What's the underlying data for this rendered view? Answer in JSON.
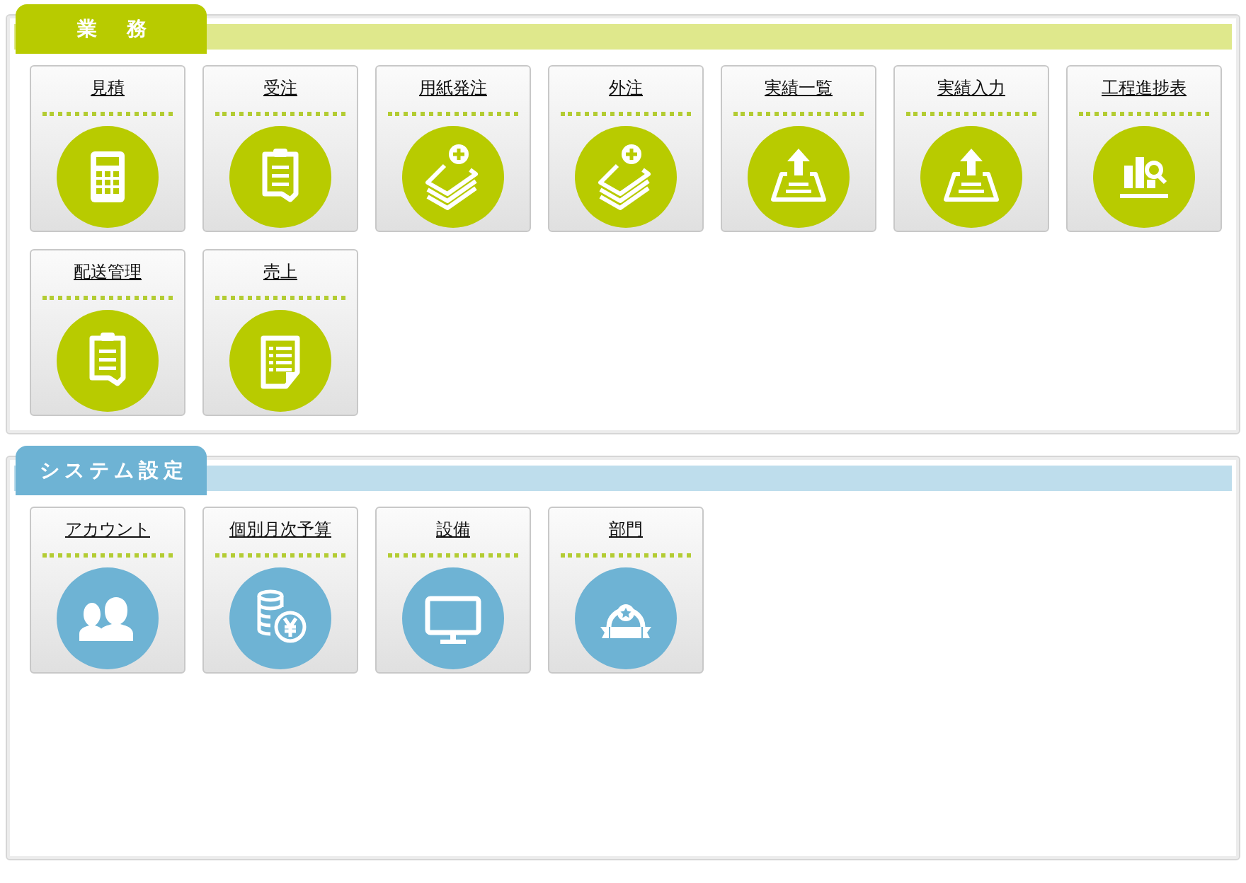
{
  "sections": [
    {
      "title": "業　務",
      "color": "#b8cb00",
      "items": [
        {
          "label": "見積",
          "kind": "calculator"
        },
        {
          "label": "受注",
          "kind": "clipboard"
        },
        {
          "label": "用紙発注",
          "kind": "stack-plus"
        },
        {
          "label": "外注",
          "kind": "stack-plus"
        },
        {
          "label": "実績一覧",
          "kind": "tray-upload"
        },
        {
          "label": "実績入力",
          "kind": "tray-upload"
        },
        {
          "label": "工程進捗表",
          "kind": "chart-search"
        },
        {
          "label": "配送管理",
          "kind": "clipboard"
        },
        {
          "label": "売上",
          "kind": "document"
        }
      ]
    },
    {
      "title": "システム設定",
      "color": "#6eb3d4",
      "items": [
        {
          "label": "アカウント",
          "kind": "users"
        },
        {
          "label": "個別月次予算",
          "kind": "coins"
        },
        {
          "label": "設備",
          "kind": "monitor"
        },
        {
          "label": "部門",
          "kind": "badge"
        }
      ]
    }
  ]
}
